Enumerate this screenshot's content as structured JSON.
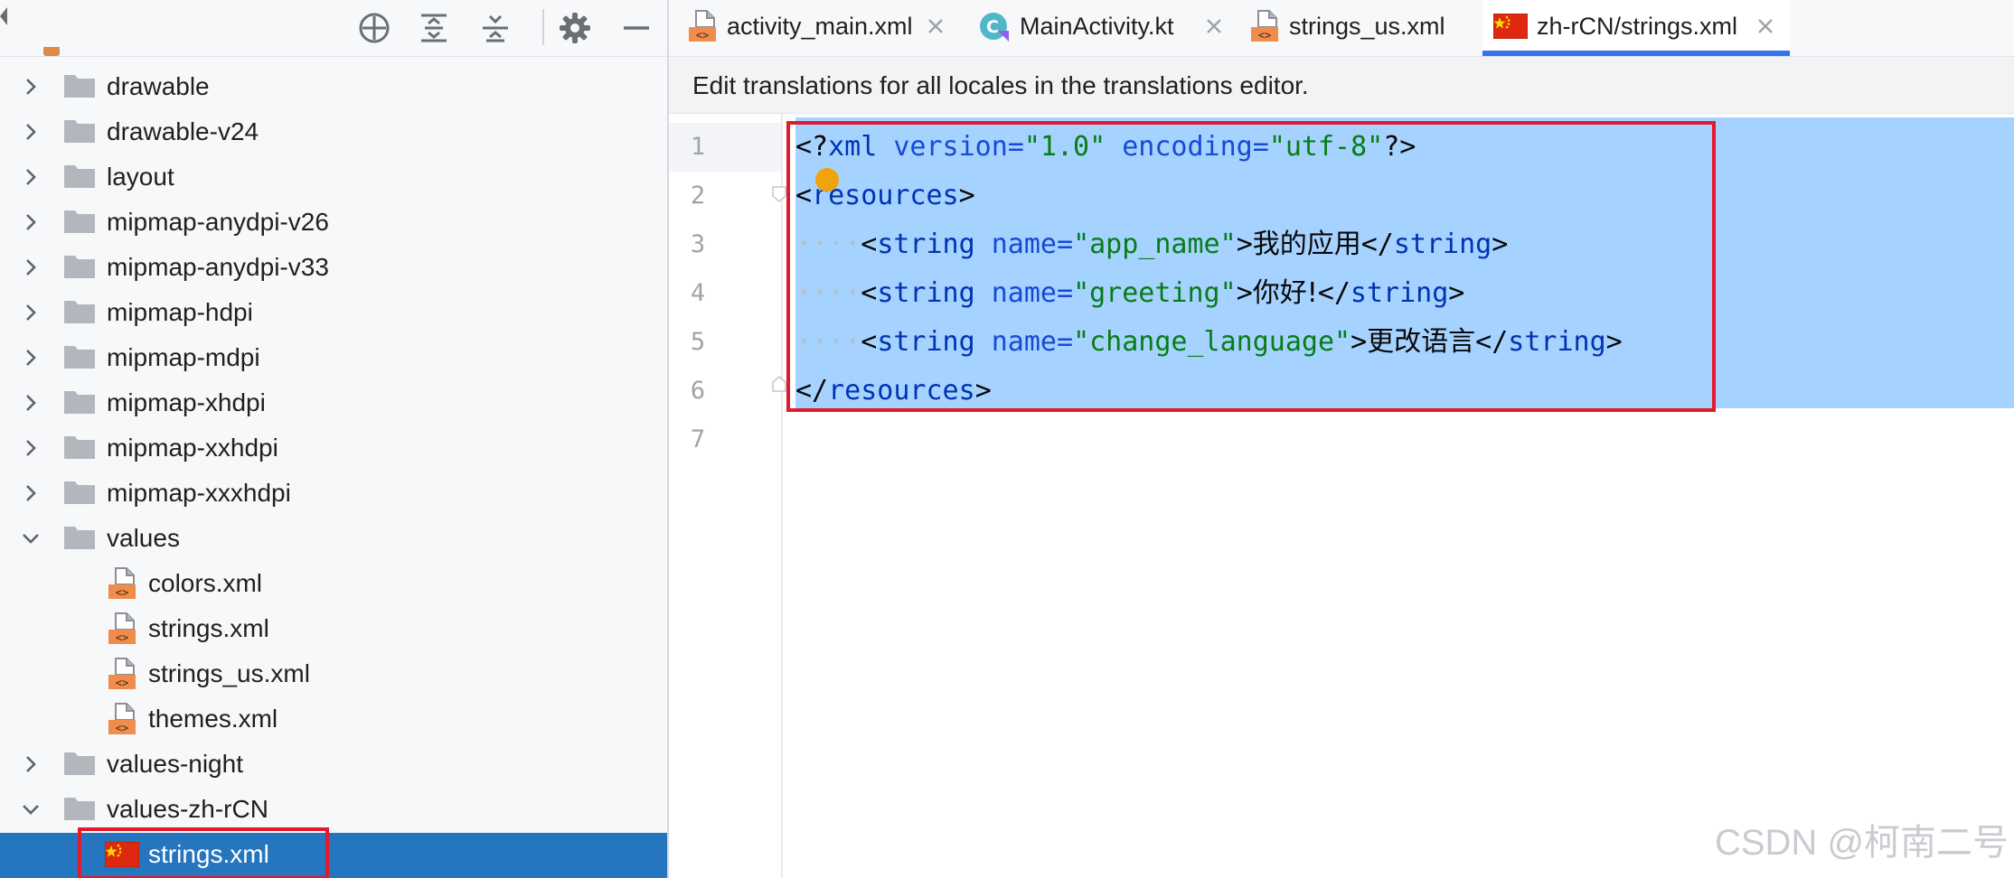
{
  "project_tree": {
    "toolbar": {
      "locate_icon": "crosshair-icon",
      "expand_icon": "expand-all-icon",
      "collapse_icon": "collapse-all-icon",
      "settings_icon": "gear-icon",
      "hide_icon": "minimize-icon"
    },
    "items": [
      {
        "label": "drawable",
        "type": "folder",
        "expanded": false
      },
      {
        "label": "drawable-v24",
        "type": "folder",
        "expanded": false
      },
      {
        "label": "layout",
        "type": "folder",
        "expanded": false
      },
      {
        "label": "mipmap-anydpi-v26",
        "type": "folder",
        "expanded": false
      },
      {
        "label": "mipmap-anydpi-v33",
        "type": "folder",
        "expanded": false
      },
      {
        "label": "mipmap-hdpi",
        "type": "folder",
        "expanded": false
      },
      {
        "label": "mipmap-mdpi",
        "type": "folder",
        "expanded": false
      },
      {
        "label": "mipmap-xhdpi",
        "type": "folder",
        "expanded": false
      },
      {
        "label": "mipmap-xxhdpi",
        "type": "folder",
        "expanded": false
      },
      {
        "label": "mipmap-xxxhdpi",
        "type": "folder",
        "expanded": false
      },
      {
        "label": "values",
        "type": "folder",
        "expanded": true
      },
      {
        "label": "colors.xml",
        "type": "xml-file"
      },
      {
        "label": "strings.xml",
        "type": "xml-file"
      },
      {
        "label": "strings_us.xml",
        "type": "xml-file"
      },
      {
        "label": "themes.xml",
        "type": "xml-file"
      },
      {
        "label": "values-night",
        "type": "folder",
        "expanded": false
      },
      {
        "label": "values-zh-rCN",
        "type": "folder",
        "expanded": true
      },
      {
        "label": "strings.xml",
        "type": "locale-file",
        "selected": true
      }
    ]
  },
  "tabs": [
    {
      "label": "activity_main.xml",
      "icon": "xml-file-icon",
      "active": false
    },
    {
      "label": "MainActivity.kt",
      "icon": "kotlin-class-icon",
      "active": false
    },
    {
      "label": "strings_us.xml",
      "icon": "xml-file-icon",
      "active": false
    },
    {
      "label": "zh-rCN/strings.xml",
      "icon": "china-flag-icon",
      "active": true
    }
  ],
  "banner": {
    "text": "Edit translations for all locales in the translations editor."
  },
  "editor": {
    "line_numbers": [
      "1",
      "2",
      "3",
      "4",
      "5",
      "6",
      "7"
    ],
    "code": {
      "l1": {
        "open": "<?",
        "tag": "xml",
        "attr1": "version",
        "eq1": "=",
        "val1": "\"1.0\"",
        "attr2": "encoding",
        "eq2": "=",
        "val2": "\"utf-8\"",
        "close": "?>"
      },
      "l2": {
        "open": "<",
        "tag": "resources",
        "close": ">"
      },
      "l3": {
        "indent": "····",
        "open": "<",
        "tag": "string",
        "attr": "name",
        "eq": "=",
        "val": "\"app_name\"",
        "gt": ">",
        "text": "我的应用",
        "end_open": "</",
        "end_tag": "string",
        "end_close": ">"
      },
      "l4": {
        "indent": "····",
        "open": "<",
        "tag": "string",
        "attr": "name",
        "eq": "=",
        "val": "\"greeting\"",
        "gt": ">",
        "text": "你好!",
        "end_open": "</",
        "end_tag": "string",
        "end_close": ">"
      },
      "l5": {
        "indent": "····",
        "open": "<",
        "tag": "string",
        "attr": "name",
        "eq": "=",
        "val": "\"change_language\"",
        "gt": ">",
        "text": "更改语言",
        "end_open": "</",
        "end_tag": "string",
        "end_close": ">"
      },
      "l6": {
        "open": "</",
        "tag": "resources",
        "close": ">"
      }
    }
  },
  "watermark": "CSDN @柯南二号",
  "colors": {
    "selection": "#a6d2ff",
    "tree_selected": "#2675bf",
    "highlight_box": "#e11b2b",
    "tag": "#0033b3",
    "attribute": "#174ad4",
    "value": "#067d17"
  }
}
